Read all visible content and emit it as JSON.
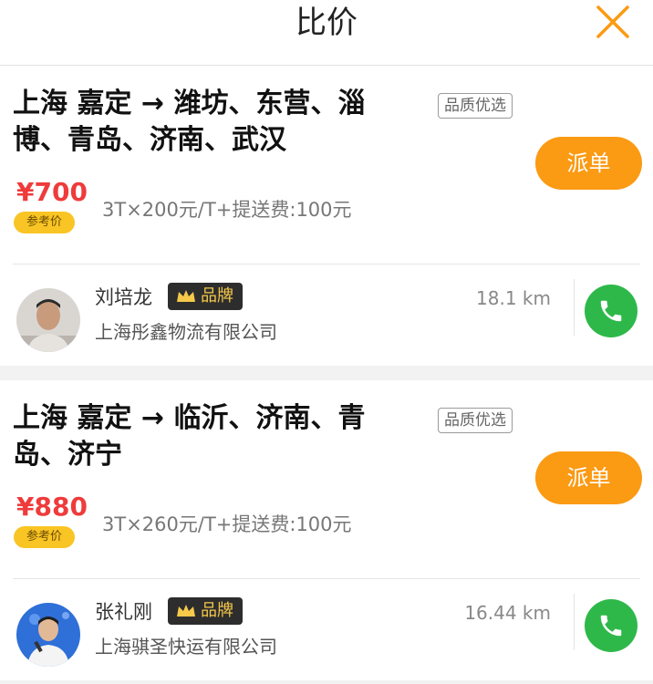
{
  "header": {
    "title": "比价",
    "close_icon": "close-icon"
  },
  "cards": [
    {
      "route": "上海 嘉定 → 潍坊、东营、淄博、青岛、济南、武汉",
      "quality_badge": "品质优选",
      "dispatch_label": "派单",
      "price": "¥700",
      "ref_label": "参考价",
      "formula": "3T×200元/T+提送费:100元",
      "provider": {
        "name": "刘培龙",
        "brand_label": "品牌",
        "company": "上海彤鑫物流有限公司",
        "distance": "18.1 km"
      }
    },
    {
      "route": "上海 嘉定 → 临沂、济南、青岛、济宁",
      "quality_badge": "品质优选",
      "dispatch_label": "派单",
      "price": "¥880",
      "ref_label": "参考价",
      "formula": "3T×260元/T+提送费:100元",
      "provider": {
        "name": "张礼刚",
        "brand_label": "品牌",
        "company": "上海骐圣快运有限公司",
        "distance": "16.44 km"
      }
    }
  ],
  "colors": {
    "accent": "#fb9a13",
    "price": "#ef3b3b",
    "phone": "#2fb84a",
    "brand_bg": "#2d2d2d",
    "brand_text": "#f6c94a"
  }
}
